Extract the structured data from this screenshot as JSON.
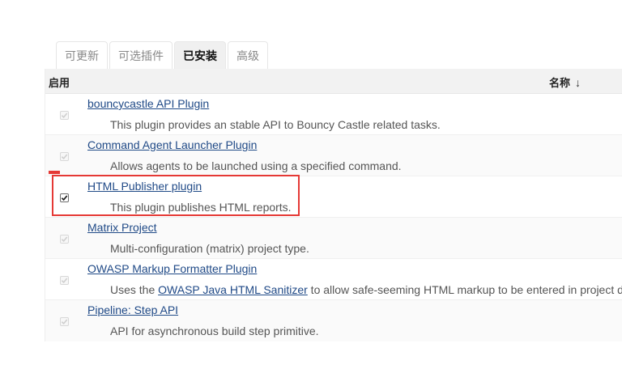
{
  "tabs": [
    {
      "label": "可更新",
      "active": false
    },
    {
      "label": "可选插件",
      "active": false
    },
    {
      "label": "已安装",
      "active": true
    },
    {
      "label": "高级",
      "active": false
    }
  ],
  "table": {
    "col_enabled": "启用",
    "col_name": "名称",
    "sort_arrow": "↓"
  },
  "plugins": [
    {
      "name": "bouncycastle API Plugin",
      "desc": "This plugin provides an stable API to Bouncy Castle related tasks.",
      "checked": true,
      "editable": false
    },
    {
      "name": "Command Agent Launcher Plugin",
      "desc": "Allows agents to be launched using a specified command.",
      "checked": true,
      "editable": false
    },
    {
      "name": "HTML Publisher plugin",
      "desc": "This plugin publishes HTML reports.",
      "checked": true,
      "editable": true
    },
    {
      "name": "Matrix Project",
      "desc": "Multi-configuration (matrix) project type.",
      "checked": true,
      "editable": false
    },
    {
      "name": "OWASP Markup Formatter Plugin",
      "desc_before": "Uses the ",
      "desc_link": "OWASP Java HTML Sanitizer",
      "desc_after": " to allow safe-seeming HTML markup to be entered in project d",
      "checked": true,
      "editable": false
    },
    {
      "name": "Pipeline: Step API",
      "desc": "API for asynchronous build step primitive.",
      "checked": true,
      "editable": false
    }
  ],
  "colors": {
    "highlight": "#e53935",
    "link": "#204a87"
  }
}
